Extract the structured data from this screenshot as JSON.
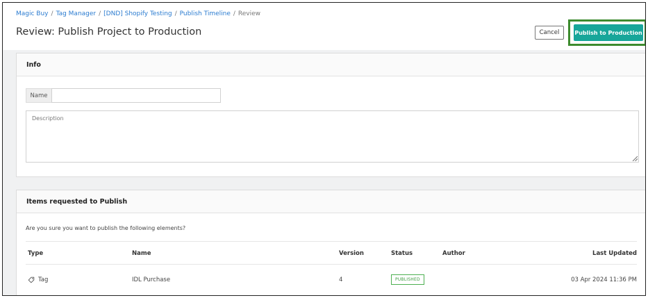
{
  "breadcrumb": [
    "Magic Buy",
    "Tag Manager",
    "[DND] Shopify Testing",
    "Publish Timeline"
  ],
  "breadcrumb_current": "Review",
  "page_title": "Review: Publish Project to Production",
  "buttons": {
    "cancel": "Cancel",
    "publish": "Publish to Production"
  },
  "info": {
    "heading": "Info",
    "name_label": "Name",
    "name_value": "",
    "description_placeholder": "Description"
  },
  "items": {
    "heading": "Items requested to Publish",
    "confirm": "Are you sure you want to publish the following elements?",
    "columns": [
      "Type",
      "Name",
      "Version",
      "Status",
      "Author",
      "Last Updated"
    ],
    "rows": [
      {
        "type": "Tag",
        "type_icon": "tag-icon",
        "name": "IDL Purchase",
        "version": "4",
        "status": "PUBLISHED",
        "author": "",
        "updated": "03 Apr 2024 11:36 PM"
      }
    ]
  },
  "colors": {
    "accent": "#17a69a",
    "link": "#2a7bd0",
    "highlight": "#3d8b2e",
    "status_green": "#4caf50"
  }
}
